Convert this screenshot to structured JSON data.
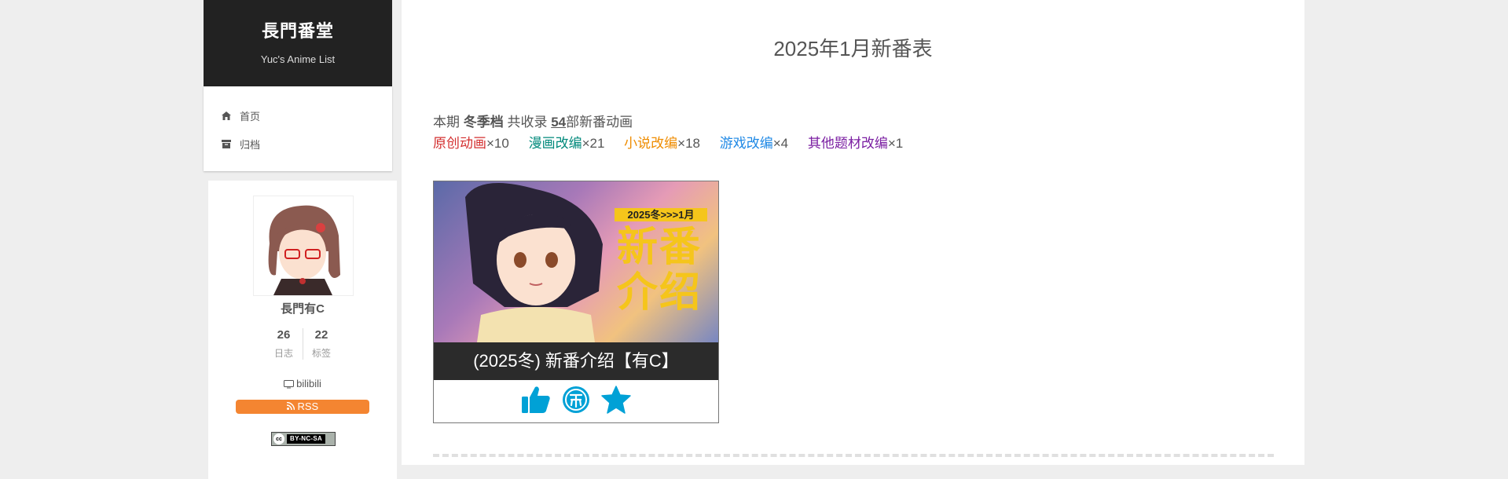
{
  "sidebar": {
    "site_title": "長門番堂",
    "site_subtitle": "Yuc's Anime List",
    "menu": [
      {
        "label": "首页",
        "icon": "home-icon"
      },
      {
        "label": "归档",
        "icon": "archive-icon"
      }
    ],
    "profile": {
      "author": "長門有C",
      "posts_count": "26",
      "posts_label": "日志",
      "tags_count": "22",
      "tags_label": "标签",
      "link_label": "bilibili",
      "rss_label": "RSS",
      "license_label": "BY-NC-SA"
    }
  },
  "main": {
    "title": "2025年1月新番表",
    "summary": {
      "prefix": "本期",
      "season": "冬季档",
      "middle": "共收录",
      "count": "54",
      "suffix": "部新番动画"
    },
    "categories": [
      {
        "label": "原创动画",
        "mult": "×10",
        "color": "#d32f2f"
      },
      {
        "label": "漫画改编",
        "mult": "×21",
        "color": "#00897b"
      },
      {
        "label": "小说改编",
        "mult": "×18",
        "color": "#ef8c00"
      },
      {
        "label": "游戏改编",
        "mult": "×4",
        "color": "#1e88e5"
      },
      {
        "label": "其他题材改编",
        "mult": "×1",
        "color": "#7b1fa2"
      }
    ],
    "card": {
      "cover_badge": "2025冬>>>1月",
      "cover_line1": "新番",
      "cover_line2": "介绍",
      "caption": "(2025冬) 新番介绍【有C】",
      "actions": [
        "like-icon",
        "coin-icon",
        "favorite-icon"
      ],
      "accent": "#00a1d6"
    }
  }
}
